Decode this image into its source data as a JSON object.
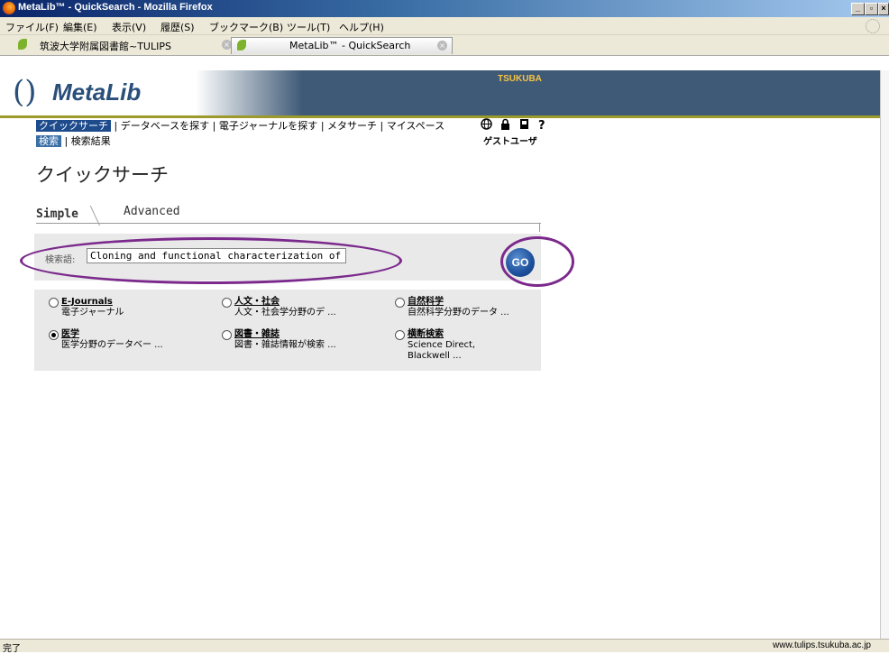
{
  "window": {
    "title": "MetaLib™ - QuickSearch - Mozilla Firefox",
    "min": "_",
    "max": "▫",
    "close": "×"
  },
  "menu": [
    "ファイル(F)",
    "編集(E)",
    "表示(V)",
    "履歴(S)",
    "ブックマーク(B)",
    "ツール(T)",
    "ヘルプ(H)"
  ],
  "tabs": [
    {
      "label": "筑波大学附属図書館~TULIPS"
    },
    {
      "label": "MetaLib™ - QuickSearch"
    }
  ],
  "header": {
    "logo": "MetaLib",
    "paren": "()",
    "institution": "TSUKUBA"
  },
  "nav": {
    "items": [
      "クイックサーチ",
      "データベースを探す",
      "電子ジャーナルを探す",
      "メタサーチ",
      "マイスペース"
    ],
    "sub": [
      "検索",
      "検索結果"
    ],
    "user": "ゲストユーザ"
  },
  "page": {
    "title": "クイックサーチ"
  },
  "search_tabs": {
    "simple": "Simple",
    "advanced": "Advanced"
  },
  "search": {
    "label": "検索語:",
    "value": "Cloning and functional characterization of a novel",
    "go": "GO"
  },
  "categories": [
    {
      "name": "E-Journals",
      "desc": "電子ジャーナル",
      "selected": false
    },
    {
      "name": "人文・社会",
      "desc": "人文・社会学分野のデ ...",
      "selected": false
    },
    {
      "name": "自然科学",
      "desc": "自然科学分野のデータ ...",
      "selected": false
    },
    {
      "name": "医学",
      "desc": "医学分野のデータベー ...",
      "selected": true
    },
    {
      "name": "図書・雑誌",
      "desc": "図書・雑誌情報が検索 ...",
      "selected": false
    },
    {
      "name": "横断検索",
      "desc": "Science Direct,",
      "desc2": "Blackwell ...",
      "selected": false
    }
  ],
  "status": {
    "text": "完了",
    "url": "www.tulips.tsukuba.ac.jp"
  }
}
